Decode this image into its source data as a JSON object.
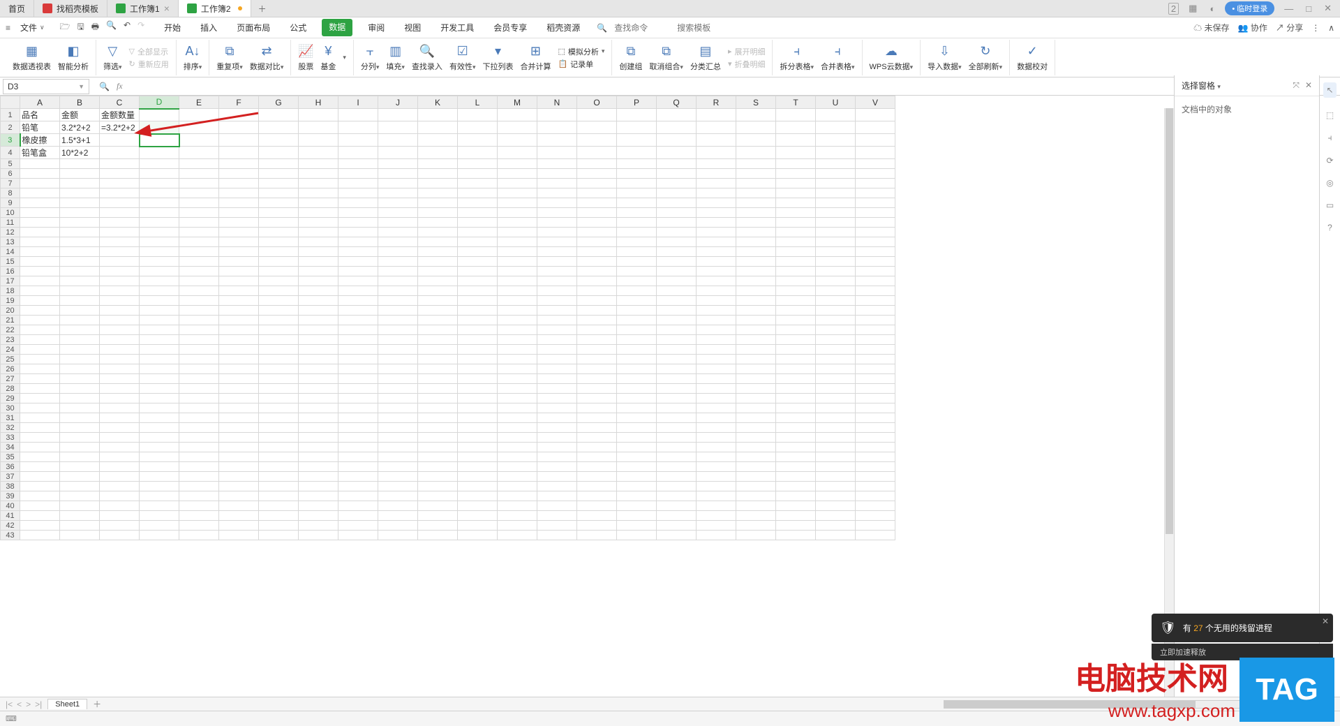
{
  "tabs": {
    "home": "首页",
    "t1": "找稻壳模板",
    "t2": "工作簿1",
    "t3": "工作簿2"
  },
  "window": {
    "badge": "2",
    "login": "临时登录"
  },
  "file_menu": "文件",
  "menu": {
    "start": "开始",
    "insert": "插入",
    "layout": "页面布局",
    "formula": "公式",
    "data": "数据",
    "review": "审阅",
    "view": "视图",
    "dev": "开发工具",
    "member": "会员专享",
    "docer": "稻壳资源"
  },
  "search": {
    "cmd_ph": "查找命令",
    "tpl_ph": "搜索模板"
  },
  "top_right": {
    "unsaved": "未保存",
    "coop": "协作",
    "share": "分享"
  },
  "ribbon": {
    "pivot": "数据透视表",
    "smart": "智能分析",
    "filter": "筛选",
    "show_all": "全部显示",
    "reapply": "重新应用",
    "sort": "排序",
    "dup": "重复项",
    "validate": "数据对比",
    "stock": "股票",
    "fund": "基金",
    "split": "分列",
    "fill": "填充",
    "lookup": "查找录入",
    "validity": "有效性",
    "dropdown": "下拉列表",
    "consolidate": "合并计算",
    "form": "记录单",
    "mock": "模拟分析",
    "group": "创建组",
    "ungroup": "取消组合",
    "subtotal": "分类汇总",
    "expand": "展开明细",
    "collapse": "折叠明细",
    "split_tbl": "拆分表格",
    "merge_tbl": "合并表格",
    "wps_cloud": "WPS云数据",
    "import": "导入数据",
    "refresh_all": "全部刷新",
    "proof": "数据校对"
  },
  "namebox": "D3",
  "panel": {
    "title": "选择窗格",
    "body": "文档中的对象"
  },
  "columns": [
    "A",
    "B",
    "C",
    "D",
    "E",
    "F",
    "G",
    "H",
    "I",
    "J",
    "K",
    "L",
    "M",
    "N",
    "O",
    "P",
    "Q",
    "R",
    "S",
    "T",
    "U",
    "V"
  ],
  "rows_count": 43,
  "cells": {
    "A1": "品名",
    "B1": "金额",
    "C1": "金额数量",
    "A2": "铅笔",
    "B2": "3.2*2+2",
    "C2": "=3.2*2+2",
    "A3": "橡皮擦",
    "B3": "1.5*3+1",
    "A4": "铅笔盒",
    "B4": "10*2+2"
  },
  "selected_cell": "D3",
  "sheet": {
    "name": "Sheet1"
  },
  "notif": {
    "prefix": "有 ",
    "count": "27",
    "suffix": " 个无用的残留进程",
    "sub": "立即加速释放"
  },
  "watermark": {
    "line1": "电脑技术网",
    "line2": "www.tagxp.com",
    "tag": "TAG"
  }
}
